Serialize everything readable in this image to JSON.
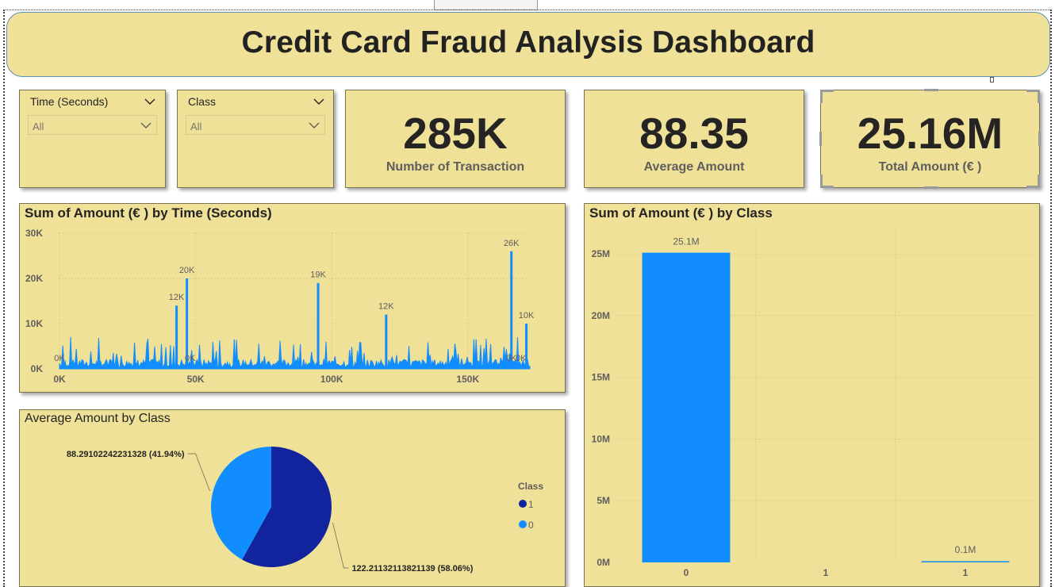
{
  "dashboard": {
    "title": "Credit Card Fraud Analysis Dashboard"
  },
  "slicers": [
    {
      "title": "Time (Seconds)",
      "value": "All"
    },
    {
      "title": "Class",
      "value": "All"
    }
  ],
  "kpis": [
    {
      "value": "285K",
      "label": "Number of Transaction"
    },
    {
      "value": "88.35",
      "label": "Average Amount"
    },
    {
      "value": "25.16M",
      "label": "Total Amount (€ )"
    }
  ],
  "time_chart": {
    "title": "Sum of Amount (€ ) by Time (Seconds)"
  },
  "class_bar_chart": {
    "title": "Sum of Amount (€ ) by Class"
  },
  "pie_chart": {
    "title": "Average Amount by Class",
    "legend_title": "Class"
  },
  "colors": {
    "panel_bg": "#efe198",
    "bar_blue": "#118dff",
    "dark_blue": "#12239e",
    "text_dark": "#252423"
  },
  "chart_data": [
    {
      "type": "area",
      "title": "Sum of Amount (€ ) by Time (Seconds)",
      "x_ticks": [
        "0K",
        "50K",
        "100K",
        "150K"
      ],
      "y_ticks": [
        "0K",
        "10K",
        "20K",
        "30K"
      ],
      "xlim": [
        0,
        172792
      ],
      "ylim": [
        0,
        30000
      ],
      "peaks": [
        {
          "x": 0,
          "y": 0,
          "label": "0K"
        },
        {
          "x": 43000,
          "y": 14000,
          "label": "12K"
        },
        {
          "x": 46800,
          "y": 20000,
          "label": "20K"
        },
        {
          "x": 48000,
          "y": 0,
          "label": "0K"
        },
        {
          "x": 95000,
          "y": 19000,
          "label": "19K"
        },
        {
          "x": 120000,
          "y": 12000,
          "label": "12K"
        },
        {
          "x": 166000,
          "y": 26000,
          "label": "26K"
        },
        {
          "x": 166000,
          "y": 0,
          "label": "0K"
        },
        {
          "x": 169500,
          "y": 0,
          "label": "0K"
        },
        {
          "x": 171500,
          "y": 10000,
          "label": "10K"
        }
      ]
    },
    {
      "type": "bar",
      "title": "Sum of Amount (€ ) by Class",
      "categories": [
        "0",
        "1",
        "1"
      ],
      "values": [
        25100000,
        0,
        100000
      ],
      "data_labels": [
        "25.1M",
        "",
        "0.1M"
      ],
      "y_ticks": [
        "0M",
        "5M",
        "10M",
        "15M",
        "20M",
        "25M"
      ],
      "ylim": [
        0,
        27000000
      ]
    },
    {
      "type": "pie",
      "title": "Average Amount by Class",
      "legend_title": "Class",
      "slices": [
        {
          "name": "1",
          "value": 122.21132113821139,
          "percent": 58.06,
          "label": "122.21132113821139 (58.06%)",
          "color": "#12239e"
        },
        {
          "name": "0",
          "value": 88.29102242231328,
          "percent": 41.94,
          "label": "88.29102242231328 (41.94%)",
          "color": "#118dff"
        }
      ]
    }
  ]
}
